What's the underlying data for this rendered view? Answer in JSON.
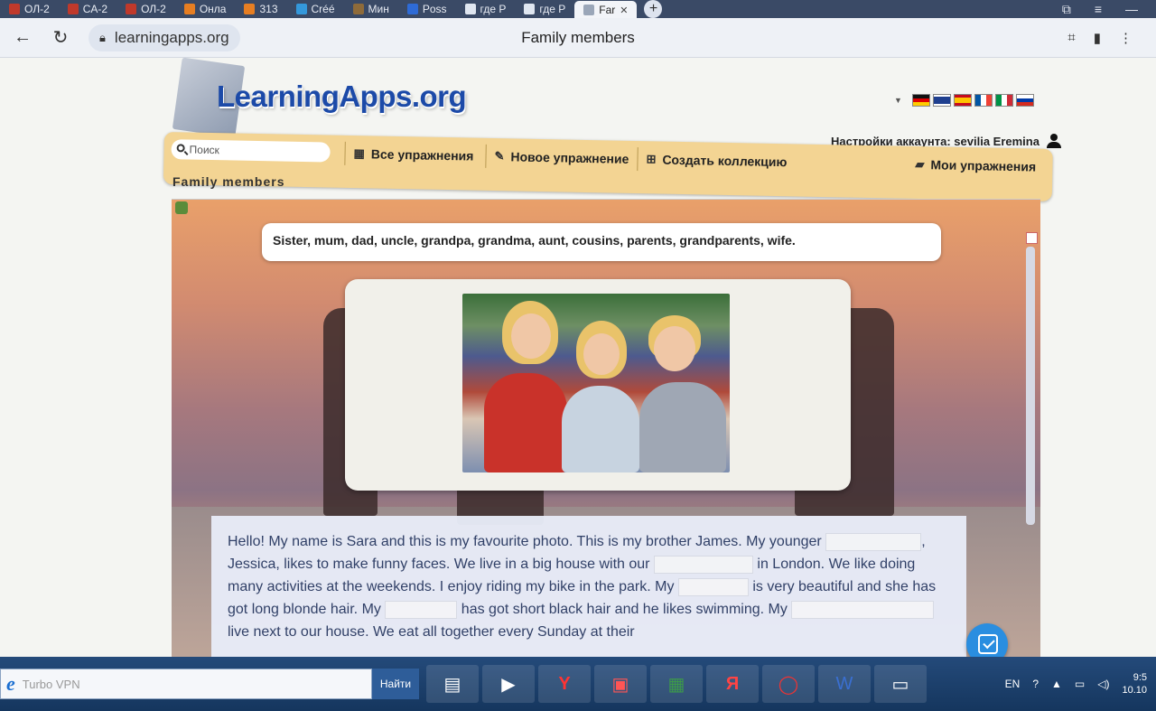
{
  "browser": {
    "tabs": [
      {
        "label": "ОЛ-2",
        "color": "#c0392b"
      },
      {
        "label": "CA-2",
        "color": "#c0392b"
      },
      {
        "label": "ОЛ-2",
        "color": "#c0392b"
      },
      {
        "label": "Онла",
        "color": "#e67e22"
      },
      {
        "label": "313",
        "color": "#e67e22"
      },
      {
        "label": "Créé",
        "color": "#3498db"
      },
      {
        "label": "Мин",
        "color": "#8e6b3a"
      },
      {
        "label": "Poss",
        "color": "#2e6bd6"
      },
      {
        "label": "где Р",
        "color": "#dfe6f0"
      },
      {
        "label": "где Р",
        "color": "#dfe6f0"
      }
    ],
    "active_tab": {
      "label": "Far",
      "close": "✕"
    },
    "new_tab": "+",
    "url": "learningapps.org",
    "page_title": "Family members"
  },
  "site": {
    "logo": "LearningApps.org",
    "languages": [
      "de",
      "en",
      "es",
      "fr",
      "it",
      "ru"
    ],
    "account_label": "Настройки аккаунта: sevilia Eremina",
    "search_placeholder": "Поиск",
    "menu": {
      "all": "Все упражнения",
      "new": "Новое упражнение",
      "collection": "Создать коллекцию",
      "mine": "Мои упражнения"
    },
    "section_title": "Family members"
  },
  "exercise": {
    "word_bank": "Sister, mum, dad, uncle, grandpa, grandma, aunt, cousins, parents, grandparents, wife.",
    "text_parts": [
      "Hello! My name is Sara and this is my favourite photo. This is my brother James. My younger",
      ", Jessica, likes to make funny faces. We live in a big house with our",
      "in London. We like doing many activities at the weekends. I enjoy riding my bike in the park. My",
      "is very beautiful and she has got long blonde hair. My",
      "has got short black hair and he likes swimming. My",
      "live next to our house. We eat all together every Sunday at their"
    ]
  },
  "taskbar": {
    "search_placeholder": "Turbo VPN",
    "find_button": "Найти",
    "lang": "EN",
    "time": "9:5",
    "date": "10.10"
  }
}
